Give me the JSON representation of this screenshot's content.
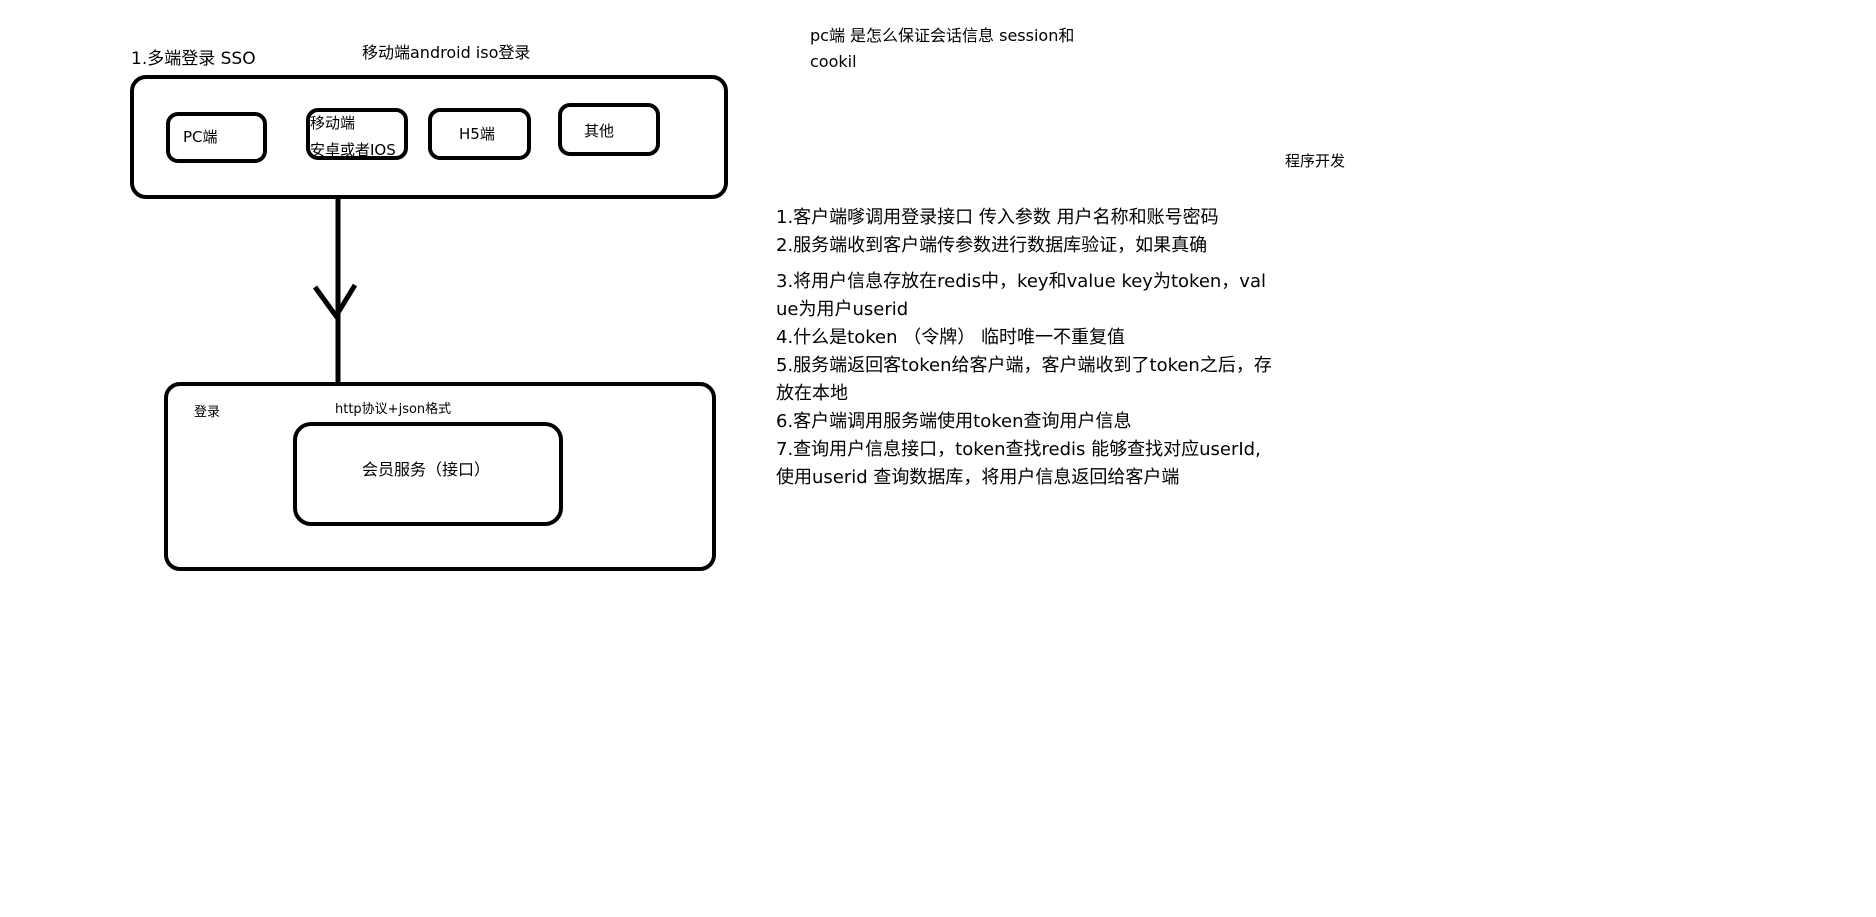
{
  "sso_title": "1.多端登录 SSO",
  "mobile_heading": "移动端android iso登录",
  "clients": {
    "pc": "PC端",
    "mobile_line1": "移动端",
    "mobile_line2": "安卓或者IOS",
    "h5": "H5端",
    "other": "其他"
  },
  "server": {
    "login_label": "登录",
    "protocol_label": "http协议+json格式",
    "member_service": "会员服务（接口）"
  },
  "pc_question_line1": "pc端 是怎么保证会话信息 session和",
  "pc_question_line2": "cookil",
  "miniprogram_label": "程序开发",
  "notes": [
    "1.客户端嗲调用登录接口 传入参数 用户名称和账号密码",
    "2.服务端收到客户端传参数进行数据库验证，如果真确",
    "3.将用户信息存放在redis中，key和value key为token，value为用户userid",
    "4.什么是token （令牌） 临时唯一不重复值",
    "5.服务端返回客token给客户端，客户端收到了token之后，存放在本地",
    "6.客户端调用服务端使用token查询用户信息",
    "7.查询用户信息接口，token查找redis 能够查找对应userId,使用userid 查询数据库，将用户信息返回给客户端"
  ]
}
